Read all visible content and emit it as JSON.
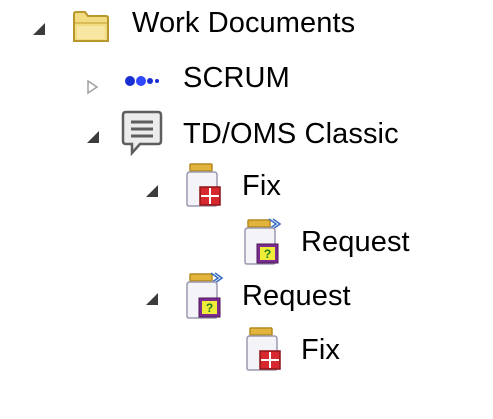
{
  "tree": {
    "root": {
      "label": "Work Documents",
      "icon": "folder-icon",
      "expanded": true,
      "children": [
        {
          "label": "SCRUM",
          "icon": "scrum-process-icon",
          "expanded": false
        },
        {
          "label": "TD/OMS Classic",
          "icon": "speech-bubble-icon",
          "expanded": true,
          "children": [
            {
              "label": "Fix",
              "icon": "fix-jar-icon",
              "expanded": true,
              "children": [
                {
                  "label": "Request",
                  "icon": "request-jar-icon"
                }
              ]
            },
            {
              "label": "Request",
              "icon": "request-jar-icon",
              "expanded": true,
              "children": [
                {
                  "label": "Fix",
                  "icon": "fix-jar-icon"
                }
              ]
            }
          ]
        }
      ]
    }
  },
  "colors": {
    "folder_fill": "#f2dc82",
    "folder_edge": "#b8972c",
    "scrum_blue": "#1a2fd1",
    "jar_lid": "#e3b43c",
    "fix_red": "#d7282f",
    "request_yellow": "#f0ec3a",
    "request_purple": "#7a2d8f",
    "expanded_triangle": "#3c3c3c",
    "collapsed_triangle": "#a0a0a0"
  }
}
